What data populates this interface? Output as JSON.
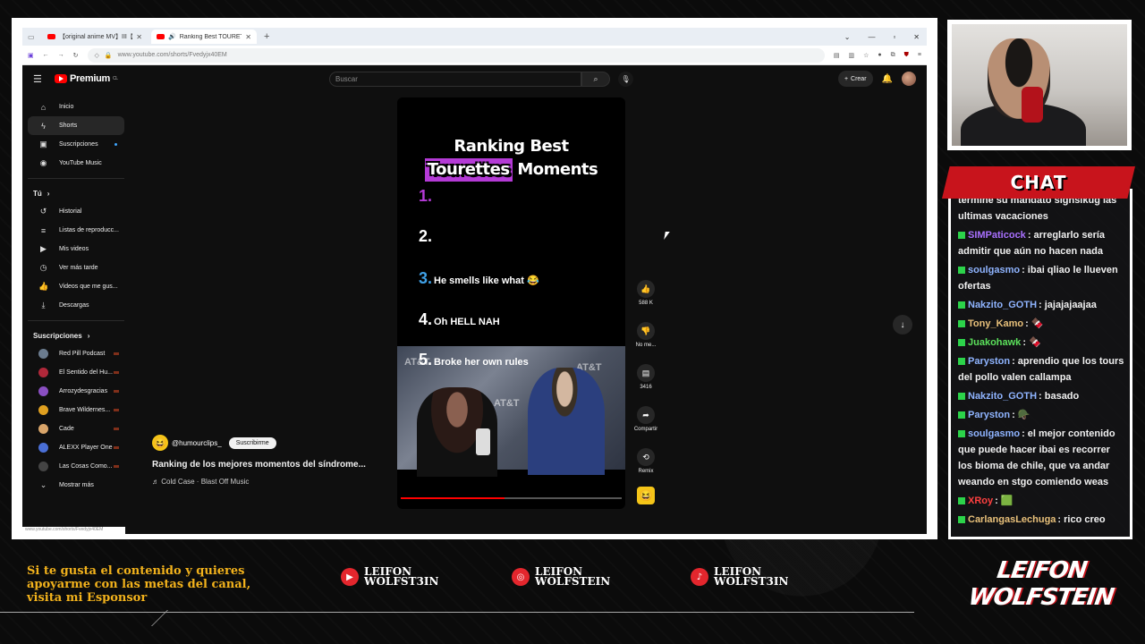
{
  "browser": {
    "tabs": [
      {
        "title": "【original anime MV】III【hololi"
      },
      {
        "title": "Ranking Best TOURETTES M"
      }
    ],
    "url": "www.youtube.com/shorts/Fvedyjx40EM"
  },
  "youtube": {
    "logo_text": "Premium",
    "logo_region": "CL",
    "search_placeholder": "Buscar",
    "create_label": "Crear",
    "sidebar": {
      "main": [
        {
          "label": "Inicio",
          "icon": "home-icon"
        },
        {
          "label": "Shorts",
          "icon": "shorts-icon"
        },
        {
          "label": "Suscripciones",
          "icon": "subscriptions-icon"
        },
        {
          "label": "YouTube Music",
          "icon": "music-icon"
        }
      ],
      "you_header": "Tú",
      "you": [
        {
          "label": "Historial"
        },
        {
          "label": "Listas de reproducc..."
        },
        {
          "label": "Mis videos"
        },
        {
          "label": "Ver más tarde"
        },
        {
          "label": "Videos que me gus..."
        },
        {
          "label": "Descargas"
        }
      ],
      "subs_header": "Suscripciones",
      "subs": [
        {
          "label": "Red Pill Podcast",
          "color": "#6b7c8f"
        },
        {
          "label": "El Sentido del Hu...",
          "color": "#b0283a"
        },
        {
          "label": "Arrozydesgracias",
          "color": "#8a4fc2"
        },
        {
          "label": "Brave Wildernes...",
          "color": "#e0a020"
        },
        {
          "label": "Cade",
          "color": "#d9a56a"
        },
        {
          "label": "ALEXX Player One",
          "color": "#4a6fd6"
        },
        {
          "label": "Las Cosas Como...",
          "color": "#444444"
        }
      ],
      "show_more": "Mostrar más"
    },
    "short": {
      "title_line1": "Ranking Best",
      "title_hl": "Tourettes",
      "title_line2_rest": "Moments",
      "ranks": [
        {
          "n": "1.",
          "text": "",
          "color": "#b43ad6"
        },
        {
          "n": "2.",
          "text": "",
          "color": "#ffffff"
        },
        {
          "n": "3.",
          "text": "He smells like what 😂",
          "color": "#3fa0e6"
        },
        {
          "n": "4.",
          "text": "Oh HELL NAH",
          "color": "#ffffff"
        },
        {
          "n": "5.",
          "text": "Broke her own rules",
          "color": "#ffffff"
        }
      ],
      "progress": 0.47
    },
    "actions": {
      "likes": "588 K",
      "dislike": "No me...",
      "comments": "3416",
      "share": "Compartir",
      "remix": "Remix"
    },
    "meta": {
      "channel": "@humourclips_",
      "subscribe": "Suscribirme",
      "description": "Ranking de los mejores momentos del síndrome...",
      "music": "Cold Case · Blast Off Music"
    },
    "status_url": "www.youtube.com/shorts/Fvedyjx40EM"
  },
  "overlay": {
    "chat_title": "CHAT",
    "chat": [
      {
        "user": "",
        "text": "termine su mandato sighsikug las ultimas vacaciones",
        "color": "#f0f0f0"
      },
      {
        "user": "SIMPaticock",
        "text": ": arreglarlo sería admitir que aún no hacen nada",
        "color": "#a970ff"
      },
      {
        "user": "soulgasmo",
        "text": ": ibai qliao le llueven ofertas",
        "color": "#8fb4ff"
      },
      {
        "user": "Nakzito_GOTH",
        "text": ": jajajajaajaa",
        "color": "#8fb4ff"
      },
      {
        "user": "Tony_Kamo",
        "text": ": 🍫",
        "color": "#e8c07a"
      },
      {
        "user": "Juakohawk",
        "text": ": 🍫",
        "color": "#5be05b"
      },
      {
        "user": "Paryston",
        "text": ": aprendio que los tours del pollo valen callampa",
        "color": "#8fb4ff"
      },
      {
        "user": "Nakzito_GOTH",
        "text": ": basado",
        "color": "#8fb4ff"
      },
      {
        "user": "Paryston",
        "text": ": 🪖",
        "color": "#8fb4ff"
      },
      {
        "user": "soulgasmo",
        "text": ": el mejor contenido que puede hacer ibai es recorrer los bioma de chile, que va andar weando en stgo comiendo weas",
        "color": "#8fb4ff"
      },
      {
        "user": "XRoy",
        "text": ": 🟩",
        "color": "#ff4040"
      },
      {
        "user": "CarlangasLechuga",
        "text": ": rico creo",
        "color": "#e8c07a"
      }
    ],
    "footer_text": "Si te gusta el contenido y quieres apoyarme con las metas del canal, visita mi Esponsor",
    "socials": [
      {
        "line1": "LEIFON",
        "line2": "WOLFST3IN",
        "icon": "youtube-icon"
      },
      {
        "line1": "LEIFON",
        "line2": "WOLFSTEIN",
        "icon": "instagram-icon"
      },
      {
        "line1": "LEIFON",
        "line2": "WOLFST3IN",
        "icon": "tiktok-icon"
      }
    ],
    "brand_line1": "LEIFON",
    "brand_line2": "WOLFSTEIN"
  }
}
